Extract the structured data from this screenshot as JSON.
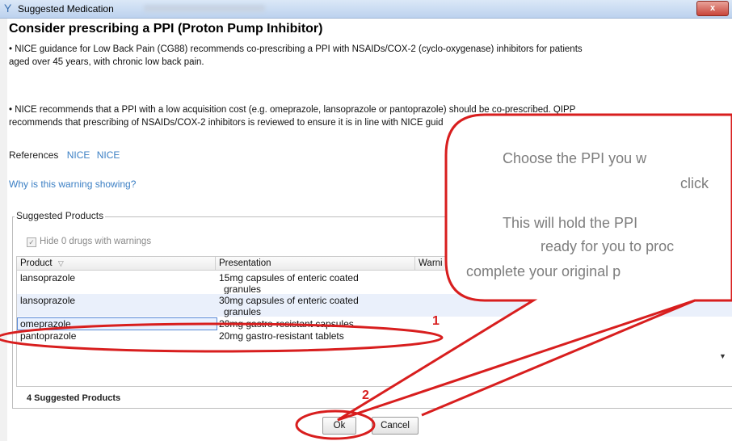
{
  "window": {
    "title": "Suggested Medication",
    "close_label": "x"
  },
  "warning": {
    "heading": "Consider prescribing a PPI (Proton Pump Inhibitor)",
    "bullet1_line1": "• NICE guidance for Low Back Pain (CG88) recommends co-prescribing a PPI with NSAIDs/COX-2 (cyclo-oxygenase) inhibitors for patients",
    "bullet1_line2": "aged over 45 years, with chronic low back pain.",
    "bullet2_line1": "• NICE recommends that a PPI with a low acquisition cost (e.g. omeprazole, lansoprazole or pantoprazole) should be co-prescribed. QIPP",
    "bullet2_line2": "recommends that prescribing of NSAIDs/COX-2 inhibitors is reviewed to ensure it is in line with NICE guid",
    "references_label": "References",
    "reference_links": [
      "NICE",
      "NICE"
    ],
    "why_link": "Why is this warning showing?"
  },
  "suggested": {
    "group_label": "Suggested Products",
    "hide_checkbox_label": "Hide 0 drugs with warnings",
    "hide_checked": true,
    "columns": [
      "Product",
      "Presentation",
      "Warni"
    ],
    "rows": [
      {
        "product": "lansoprazole",
        "presentation": "15mg capsules of enteric coated",
        "presentation2": "granules"
      },
      {
        "product": "lansoprazole",
        "presentation": "30mg capsules of enteric coated",
        "presentation2": "granules"
      },
      {
        "product": "omeprazole",
        "presentation": "20mg gastro-resistant capsules",
        "presentation2": ""
      },
      {
        "product": "pantoprazole",
        "presentation": "20mg gastro-resistant tablets",
        "presentation2": ""
      }
    ],
    "selected_row": 2,
    "count_label": "4 Suggested Products"
  },
  "buttons": {
    "ok": "Ok",
    "cancel": "Cancel"
  },
  "callout": {
    "line1": "Choose the PPI you w",
    "line2": "click",
    "line3": "This will hold the PPI",
    "line4": "ready for you to proc",
    "line5": "complete your original p"
  },
  "markers": {
    "step1": "1",
    "step2": "2"
  },
  "colors": {
    "accent_red": "#d81e1e",
    "link_blue": "#3b7fc4"
  }
}
